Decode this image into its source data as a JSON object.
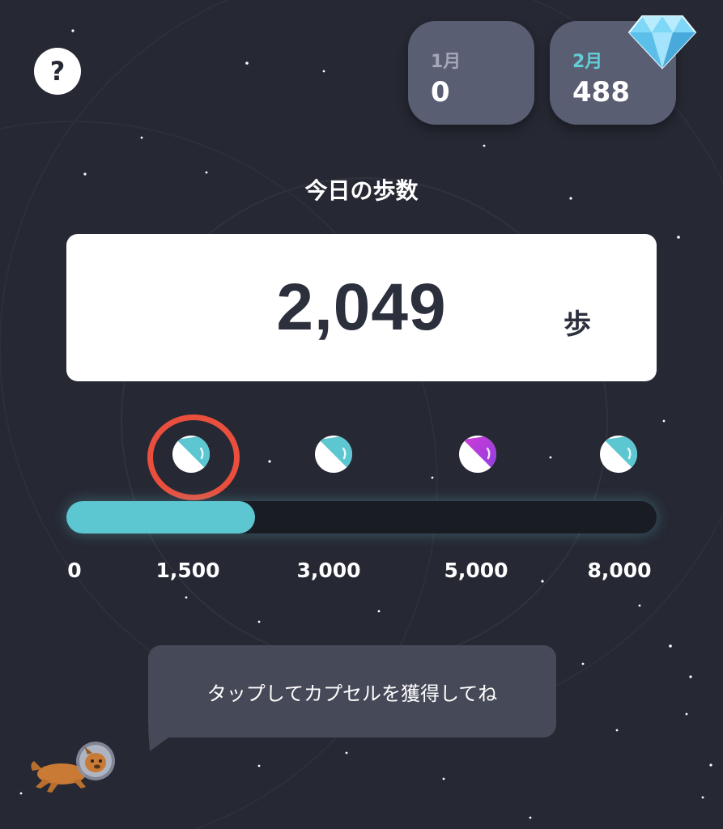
{
  "help": {
    "label": "?"
  },
  "months": [
    {
      "label": "1月",
      "value": "0"
    },
    {
      "label": "2月",
      "value": "488"
    }
  ],
  "today": {
    "label": "今日の歩数",
    "steps": "2,049",
    "unit": "歩"
  },
  "progress": {
    "fraction": 0.32,
    "milestones": [
      "0",
      "1,500",
      "3,000",
      "5,000",
      "8,000"
    ]
  },
  "capsules": [
    {
      "name": "capsule-1500",
      "color": "#5cc6d1",
      "highlighted": true
    },
    {
      "name": "capsule-3000",
      "color": "#5cc6d1",
      "highlighted": false
    },
    {
      "name": "capsule-5000",
      "color": "#8b3fe0",
      "highlighted": false
    },
    {
      "name": "capsule-8000",
      "color": "#5cc6d1",
      "highlighted": false
    }
  ],
  "colors": {
    "background": "#262833",
    "accent": "#5cc6d1",
    "highlight": "#ea4f3d"
  },
  "bubble": {
    "text": "タップしてカプセルを獲得してね"
  },
  "icons": [
    "help-icon",
    "diamond-icon",
    "capsule-icon",
    "astronaut-dog-icon"
  ]
}
